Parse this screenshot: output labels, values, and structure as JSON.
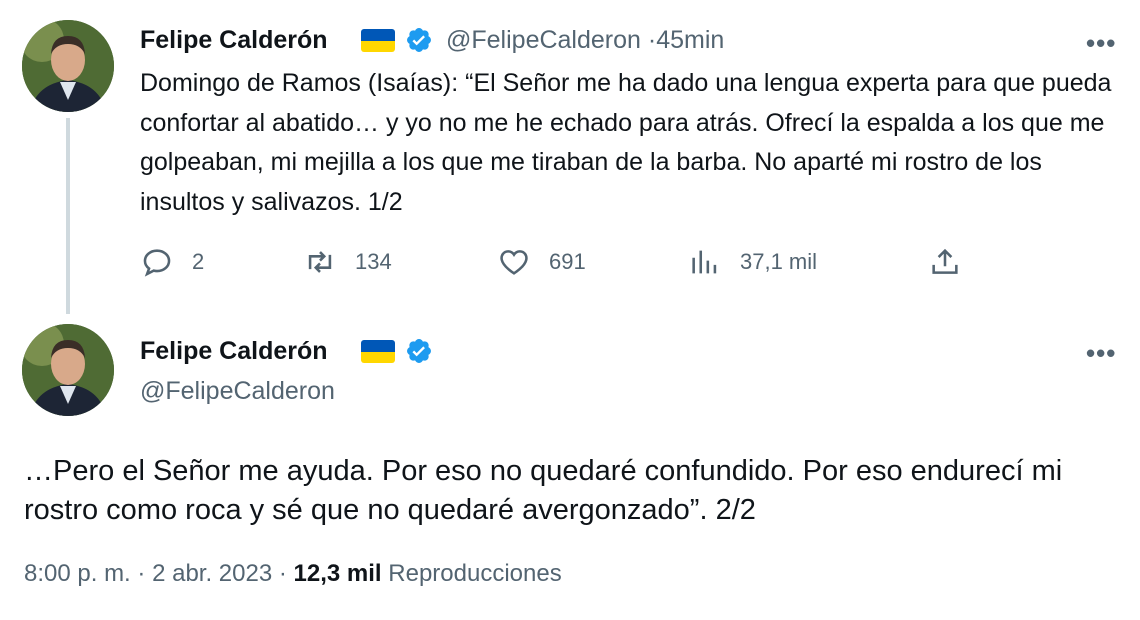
{
  "tweet1": {
    "author_name": "Felipe Calderón",
    "handle": "@FelipeCalderon",
    "separator": "·",
    "time": "45min",
    "text": "Domingo de Ramos (Isaías): “El Señor me ha dado una lengua experta para que pueda confortar al abatido… y yo no me he echado para atrás. Ofrecí la espalda a los que me golpeaban, mi mejilla a los que me tiraban de la barba. No aparté mi rostro de los insultos y salivazos. 1/2",
    "more": "•••",
    "replies": "2",
    "retweets": "134",
    "likes": "691",
    "views": "37,1 mil",
    "icons": [
      "reply-icon",
      "retweet-icon",
      "like-icon",
      "views-icon",
      "share-icon"
    ]
  },
  "tweet2": {
    "author_name": "Felipe Calderón",
    "handle": "@FelipeCalderon",
    "more": "•••",
    "text": "…Pero el Señor me ayuda. Por eso no quedaré confundido. Por eso endurecí mi rostro como roca y sé que no quedaré avergonzado”. 2/2",
    "time": "8:00 p. m.",
    "sep1": "·",
    "date": "2 abr. 2023",
    "sep2": "·",
    "views_count": "12,3 mil",
    "views_label": "Reproducciones"
  },
  "colors": {
    "verified": "#1d9bf0",
    "flag_blue": "#0057b7",
    "flag_yellow": "#ffd700",
    "secondary_text": "#536471",
    "thread_line": "#cfd9de"
  }
}
